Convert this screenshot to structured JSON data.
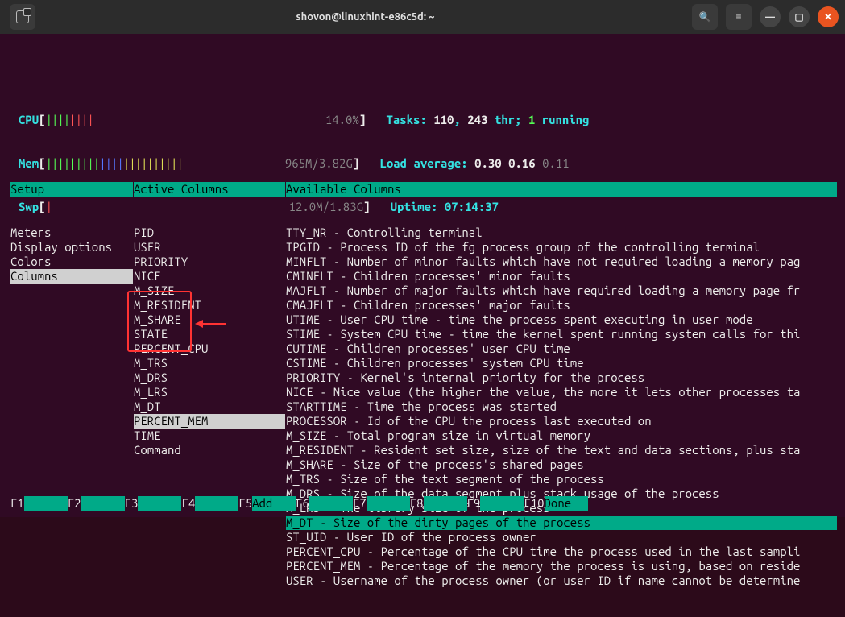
{
  "titlebar": {
    "title": "shovon@linuxhint-e86c5d: ~"
  },
  "stats": {
    "cpu": {
      "label": "CPU",
      "pct": "14.0%"
    },
    "mem": {
      "label": "Mem",
      "val": "965M/3.82G"
    },
    "swp": {
      "label": "Swp",
      "val": "12.0M/1.83G"
    },
    "tasks_label": "Tasks: ",
    "tasks_procs": "110",
    "tasks_thr": "243",
    "thr_lbl": " thr; ",
    "tasks_running": "1",
    "running_lbl": " running",
    "load_label": "Load average: ",
    "load1": "0.30",
    "load2": "0.16",
    "load3": "0.11",
    "uptime_label": "Uptime: ",
    "uptime": "07:14:37"
  },
  "headers": {
    "setup": "Setup",
    "active": "Active Columns",
    "available": "Available Columns"
  },
  "setup_items": [
    "Meters",
    "Display options",
    "Colors",
    "Columns"
  ],
  "setup_selected": 3,
  "active_cols": [
    "PID",
    "USER",
    "PRIORITY",
    "NICE",
    "M_SIZE",
    "M_RESIDENT",
    "M_SHARE",
    "STATE",
    "PERCENT_CPU",
    "M_TRS",
    "M_DRS",
    "M_LRS",
    "M_DT",
    "PERCENT_MEM",
    "TIME",
    "Command"
  ],
  "active_selected": 13,
  "avail_cols": [
    "TTY_NR - Controlling terminal",
    "TPGID - Process ID of the fg process group of the controlling terminal",
    "MINFLT - Number of minor faults which have not required loading a memory pag",
    "CMINFLT - Children processes' minor faults",
    "MAJFLT - Number of major faults which have required loading a memory page fr",
    "CMAJFLT - Children processes' major faults",
    "UTIME - User CPU time - time the process spent executing in user mode",
    "STIME - System CPU time - time the kernel spent running system calls for thi",
    "CUTIME - Children processes' user CPU time",
    "CSTIME - Children processes' system CPU time",
    "PRIORITY - Kernel's internal priority for the process",
    "NICE - Nice value (the higher the value, the more it lets other processes ta",
    "STARTTIME - Time the process was started",
    "PROCESSOR - Id of the CPU the process last executed on",
    "M_SIZE - Total program size in virtual memory",
    "M_RESIDENT - Resident set size, size of the text and data sections, plus sta",
    "M_SHARE - Size of the process's shared pages",
    "M_TRS - Size of the text segment of the process",
    "M_DRS - Size of the data segment plus stack usage of the process",
    "M_LRS - The library size of the process",
    "M_DT - Size of the dirty pages of the process",
    "ST_UID - User ID of the process owner",
    "PERCENT_CPU - Percentage of the CPU time the process used in the last sampli",
    "PERCENT_MEM - Percentage of the memory the process is using, based on reside",
    "USER - Username of the process owner (or user ID if name cannot be determine"
  ],
  "avail_highlighted": 20,
  "fkeys": [
    {
      "key": "F1",
      "label": "      "
    },
    {
      "key": "F2",
      "label": "      "
    },
    {
      "key": "F3",
      "label": "      "
    },
    {
      "key": "F4",
      "label": "      "
    },
    {
      "key": "F5",
      "label": "Add   "
    },
    {
      "key": "F6",
      "label": "      "
    },
    {
      "key": "F7",
      "label": "      "
    },
    {
      "key": "F8",
      "label": "      "
    },
    {
      "key": "F9",
      "label": "      "
    },
    {
      "key": "F10",
      "label": "Done  "
    }
  ]
}
